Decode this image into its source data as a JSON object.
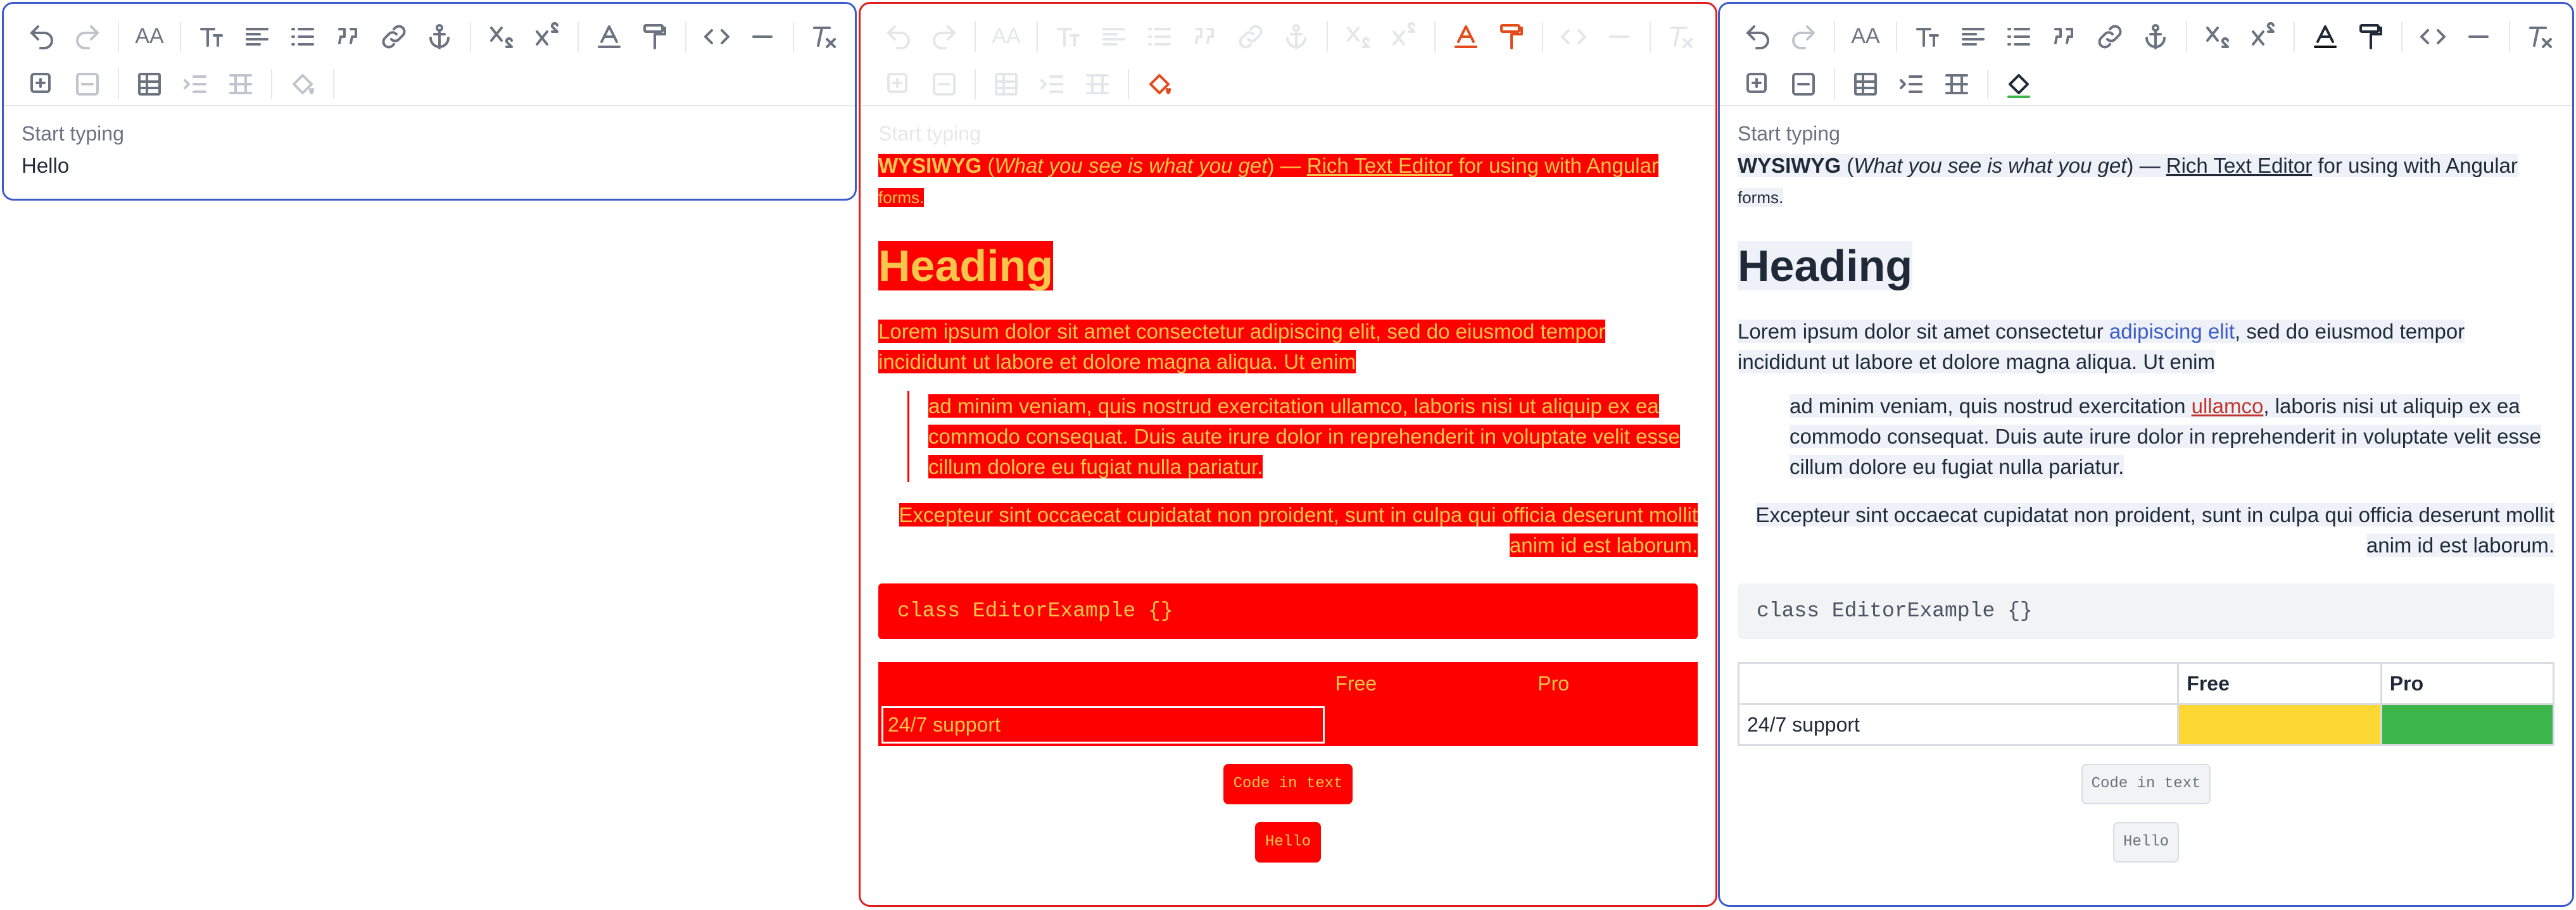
{
  "toolbar": {
    "row1": [
      "undo",
      "redo",
      "font-size",
      "text-style",
      "align-left",
      "bullet-list",
      "blockquote",
      "link",
      "anchor",
      "subscript",
      "superscript",
      "text-color",
      "paint-roller",
      "code",
      "horizontal-rule",
      "clear-format"
    ],
    "row2": [
      "insert-row",
      "remove-row",
      "table",
      "indent",
      "column-table",
      "fill-bucket"
    ],
    "font_size_label": "AA"
  },
  "panel1": {
    "placeholder": "Start typing",
    "text": "Hello"
  },
  "editor": {
    "placeholder": "Start typing",
    "p1": {
      "abbr": "WYSIWYG",
      "open": " (",
      "italic": "What you see is what you get",
      "close": ") — ",
      "underlined": "Rich Text Editor",
      "rest": " for using with Angular",
      "small": "forms."
    },
    "heading": "Heading",
    "p2": {
      "before": "Lorem ipsum dolor sit amet consectetur ",
      "link": "adipiscing elit",
      "after": ", sed do eiusmod tempor incididunt ut labore et dolore magna aliqua. Ut enim"
    },
    "quote": {
      "before": "ad minim veniam, quis nostrud exercitation ",
      "mark": "ullamco",
      "after": ", laboris nisi ut aliquip ex ea commodo consequat. Duis aute irure dolor in reprehenderit in voluptate velit esse cillum dolore eu fugiat nulla pariatur."
    },
    "right_para": "Excepteur sint occaecat cupidatat non proident, sunt in culpa qui officia deserunt mollit anim id est laborum.",
    "code": "class EditorExample {}",
    "table": {
      "headers": [
        "",
        "Free",
        "Pro"
      ],
      "row_label": "24/7 support"
    },
    "code_in_text": "Code in text",
    "hello_chip": "Hello"
  },
  "colors": {
    "accent": "#3b5bcc",
    "debug_red": "#ff0000",
    "free_cell": "#fdd835",
    "pro_cell": "#3cb54a",
    "link": "#3d5cc7"
  }
}
